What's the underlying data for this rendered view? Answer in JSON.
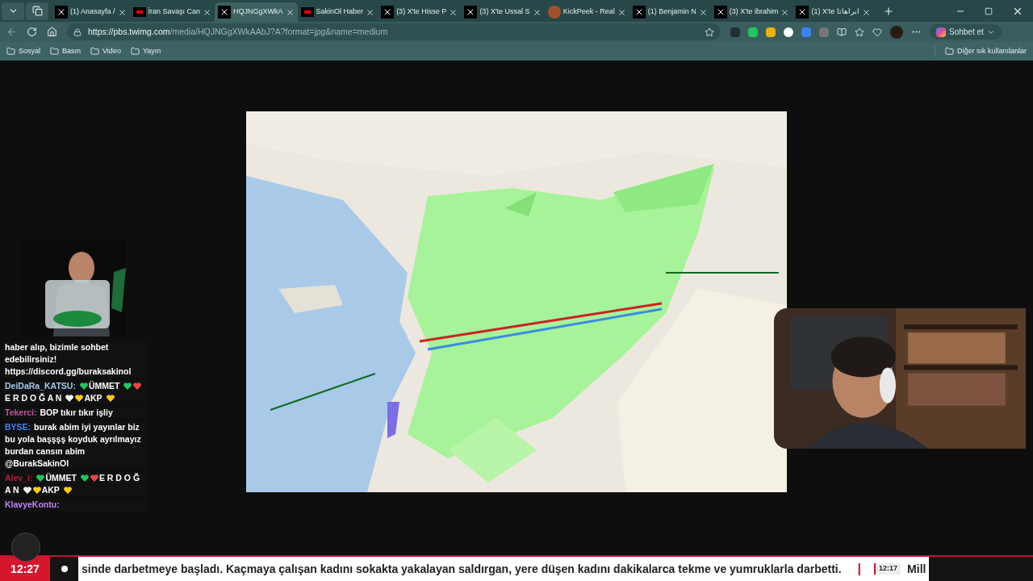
{
  "tabs": [
    {
      "title": "(1) Anasayfa /",
      "selected": false,
      "kind": "x"
    },
    {
      "title": "İran Savaşı Can",
      "selected": false,
      "kind": "news"
    },
    {
      "title": "HQJNGgXWkA",
      "selected": true,
      "kind": "x"
    },
    {
      "title": "SakinOl Haber",
      "selected": false,
      "kind": "news"
    },
    {
      "title": "(3) X'te Hisse P",
      "selected": false,
      "kind": "x"
    },
    {
      "title": "(3) X'te Ussal S",
      "selected": false,
      "kind": "x"
    },
    {
      "title": "KickPeek - Real",
      "selected": false,
      "kind": "round"
    },
    {
      "title": "(1) Benjamin N",
      "selected": false,
      "kind": "x"
    },
    {
      "title": "(3) X'te ibrahim",
      "selected": false,
      "kind": "x"
    },
    {
      "title": "(1) X'te ابراهاتا",
      "selected": false,
      "kind": "x"
    }
  ],
  "address": {
    "host": "https://pbs.twimg.com",
    "path": "/media/HQJNGgXWkAAbJ?A?format=jpg&name=medium"
  },
  "copilot_label": "Sohbet et",
  "bookmarks": [
    "Sosyal",
    "Basın",
    "Video",
    "Yayın"
  ],
  "other_bookmarks": "Diğer sık kullanılanlar",
  "chat": [
    {
      "parts": [
        {
          "kind": "text",
          "text": "haber alıp, bizimle sohbet edebilirsiniz! https://discord.gg/buraksakinol"
        }
      ]
    },
    {
      "user": "DeiDaRa_KATSU:",
      "color": "#a5c8f0",
      "parts": [
        {
          "kind": "heart",
          "color": "#22c55e"
        },
        {
          "kind": "text",
          "text": "ÜMMET"
        },
        {
          "kind": "heart",
          "color": "#22c55e"
        },
        {
          "kind": "heart",
          "color": "#ef4444"
        },
        {
          "kind": "text",
          "text": "E R D O Ğ A N"
        },
        {
          "kind": "heart",
          "color": "#f3f4f6"
        },
        {
          "kind": "heart",
          "color": "#facc15"
        },
        {
          "kind": "text",
          "text": "AKP"
        },
        {
          "kind": "heart",
          "color": "#facc15"
        }
      ]
    },
    {
      "user": "Tekerci:",
      "color": "#c0549a",
      "parts": [
        {
          "kind": "text",
          "text": "BOP tıkır tıkır işliy"
        }
      ]
    },
    {
      "user": "BYSE:",
      "color": "#3b82f6",
      "parts": [
        {
          "kind": "text",
          "text": "burak abim iyi yayınlar biz"
        },
        {
          "kind": "text",
          "text": "bu yola başşşş koyduk ayrılmayız"
        },
        {
          "kind": "text",
          "text": "burdan cansın abim"
        },
        {
          "kind": "text",
          "text": "@BurakSakinOl"
        }
      ]
    },
    {
      "user": "Alev_i:",
      "color": "#b91c3c",
      "parts": [
        {
          "kind": "heart",
          "color": "#22c55e"
        },
        {
          "kind": "text",
          "text": "ÜMMET"
        },
        {
          "kind": "heart",
          "color": "#22c55e"
        },
        {
          "kind": "heart",
          "color": "#ef4444"
        },
        {
          "kind": "text",
          "text": "E R D O Ğ"
        },
        {
          "kind": "text",
          "text": "A N"
        },
        {
          "kind": "heart",
          "color": "#f3f4f6"
        },
        {
          "kind": "heart",
          "color": "#facc15"
        },
        {
          "kind": "text",
          "text": "AKP"
        },
        {
          "kind": "heart",
          "color": "#facc15"
        }
      ]
    },
    {
      "user": "KlavyeKontu:",
      "color": "#c084fc"
    }
  ],
  "ticker": {
    "time": "12:27",
    "headline": "sinde darbetmeye başladı. Kaçmaya çalışan kadını sokakta yakalayan saldırgan, yere düşen kadını dakikalarca tekme ve yumruklarla darbetti.",
    "separator": "|",
    "next_time": "12:17",
    "next_headline": "Mill"
  }
}
